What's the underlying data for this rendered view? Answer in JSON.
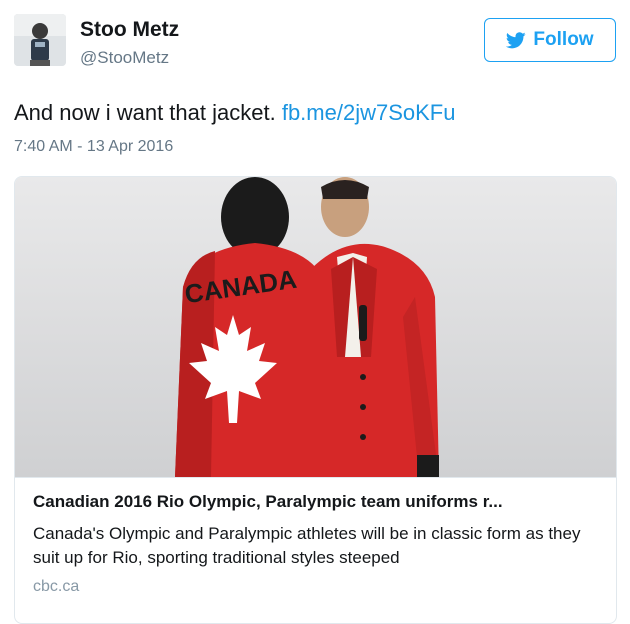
{
  "user": {
    "display_name": "Stoo Metz",
    "handle": "@StooMetz"
  },
  "follow_button": {
    "label": "Follow",
    "icon": "twitter-bird-icon",
    "color": "#1da1f2"
  },
  "tweet": {
    "text": "And now i want that jacket.",
    "link": "fb.me/2jw7SoKFu",
    "timestamp": "7:40 AM - 13 Apr 2016"
  },
  "card": {
    "image_jacket_text": "CANADA",
    "title": "Canadian 2016 Rio Olympic, Paralympic team uniforms r...",
    "description": "Canada's Olympic and Paralympic athletes will be in classic form as they suit up for Rio, sporting traditional styles steeped",
    "domain": "cbc.ca"
  }
}
